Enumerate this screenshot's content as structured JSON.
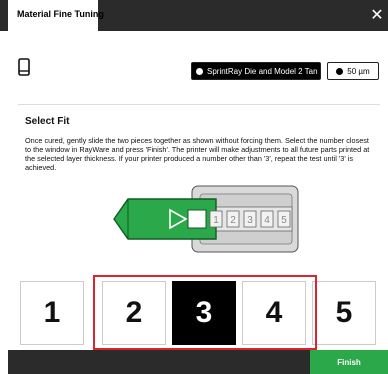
{
  "window": {
    "tab_title": "Material Fine Tuning",
    "close_icon": "close-icon"
  },
  "toolbar": {
    "device_icon": "tablet-icon",
    "material_label": "SprintRay Die and Model 2 Tan",
    "layer_label": "50 µm"
  },
  "section": {
    "heading": "Select Fit",
    "description": "Once cured, gently slide the two pieces together as shown without forcing them. Select the number closest to the window in RayWare and press 'Finish'. The printer will make adjustments to all future parts printed at the selected layer thickness. If your printer produced a number other than '3', repeat the test until '3' is achieved."
  },
  "diagram": {
    "numbers": [
      "1",
      "2",
      "3",
      "4",
      "5"
    ]
  },
  "fit_options": [
    "1",
    "2",
    "3",
    "4",
    "5"
  ],
  "selected_fit": "3",
  "footer": {
    "finish_label": "Finish"
  },
  "colors": {
    "accent_green": "#2aa84a",
    "highlight_red": "#d9262c",
    "dark_bar": "#2b2b2b"
  }
}
